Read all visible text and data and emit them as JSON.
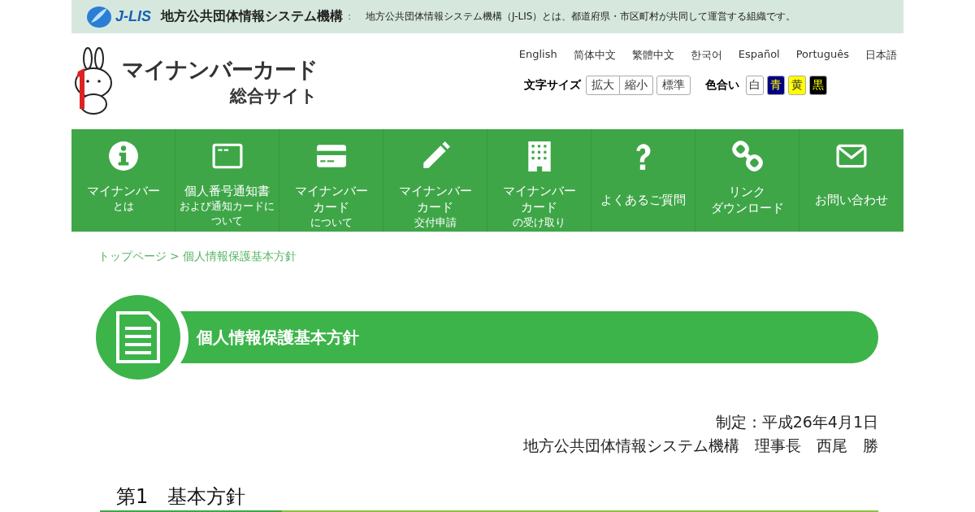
{
  "top_bar": {
    "logo": "J-LIS",
    "org": "地方公共団体情報システム機構",
    "separator": "：",
    "description": "地方公共団体情報システム機構（J-LIS）とは、都道府県・市区町村が共同して運営する組織です。"
  },
  "header": {
    "site_title": "マイナンバーカード",
    "site_subtitle": "総合サイト",
    "languages": [
      "English",
      "简体中文",
      "繁體中文",
      "한국어",
      "Español",
      "Português",
      "日本語"
    ],
    "font_size": {
      "label": "文字サイズ",
      "buttons": [
        "拡大",
        "縮小",
        "標準"
      ]
    },
    "color_scheme": {
      "label": "色合い",
      "buttons": [
        {
          "label": "白",
          "kind": "white"
        },
        {
          "label": "青",
          "kind": "blue"
        },
        {
          "label": "黄",
          "kind": "yellow"
        },
        {
          "label": "黒",
          "kind": "black"
        }
      ]
    }
  },
  "nav": [
    {
      "kind": "info",
      "lines": [
        "マイナンバー"
      ],
      "sub": "とは"
    },
    {
      "kind": "window",
      "lines": [
        "個人番号通知書"
      ],
      "sub": "および通知カードについて"
    },
    {
      "kind": "card",
      "lines": [
        "マイナンバー",
        "カード"
      ],
      "sub": "について"
    },
    {
      "kind": "pencil",
      "lines": [
        "マイナンバー",
        "カード"
      ],
      "sub": "交付申請"
    },
    {
      "kind": "building",
      "lines": [
        "マイナンバー",
        "カード"
      ],
      "sub": "の受け取り"
    },
    {
      "kind": "question",
      "lines": [
        "よくあるご質問"
      ]
    },
    {
      "kind": "link",
      "lines": [
        "リンク",
        "ダウンロード"
      ]
    },
    {
      "kind": "mail",
      "lines": [
        "お問い合わせ"
      ]
    }
  ],
  "breadcrumb": {
    "home": "トップページ",
    "separator": ">",
    "current": "個人情報保護基本方針"
  },
  "page_title": "個人情報保護基本方針",
  "enactment": [
    "制定：平成26年4月1日",
    "地方公共団体情報システム機構　理事長　西尾　勝"
  ],
  "section_heading": "第1　基本方針"
}
